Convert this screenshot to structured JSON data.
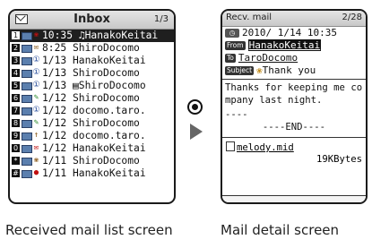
{
  "list_screen": {
    "title": "Inbox",
    "page": "1/3",
    "rows": [
      {
        "num": "1",
        "status": "❀",
        "status_color": "red",
        "text": "10:35 ♫HanakoKeitai",
        "selected": true
      },
      {
        "num": "2",
        "status": "✉",
        "status_color": "brown",
        "text": " 8:25 ShiroDocomo",
        "selected": false
      },
      {
        "num": "3",
        "status": "①",
        "status_color": "blue",
        "text": " 1/13 HanakoKeitai",
        "selected": false
      },
      {
        "num": "4",
        "status": "①",
        "status_color": "blue",
        "text": " 1/13 ShiroDocomo",
        "selected": false
      },
      {
        "num": "5",
        "status": "①",
        "status_color": "blue",
        "text": " 1/13 ▤ShiroDocomo",
        "selected": false
      },
      {
        "num": "6",
        "status": "✎",
        "status_color": "green",
        "text": " 1/12 ShiroDocomo",
        "selected": false
      },
      {
        "num": "7",
        "status": "①",
        "status_color": "blue",
        "text": " 1/12 docomo.taro.",
        "selected": false
      },
      {
        "num": "8",
        "status": "✎",
        "status_color": "green",
        "text": " 1/12 ShiroDocomo",
        "selected": false
      },
      {
        "num": "9",
        "status": "↑",
        "status_color": "brown",
        "text": " 1/12 docomo.taro.",
        "selected": false
      },
      {
        "num": "0",
        "status": "✉",
        "status_color": "red",
        "text": " 1/12 HanakoKeitai",
        "selected": false
      },
      {
        "num": "*",
        "status": "❀",
        "status_color": "brown",
        "text": " 1/11 ShiroDocomo",
        "selected": false
      },
      {
        "num": "#",
        "status": "●",
        "status_color": "red",
        "text": " 1/11 HanakoKeitai",
        "selected": false
      }
    ]
  },
  "detail_screen": {
    "title": "Recv. mail",
    "page": "2/28",
    "date": "2010/ 1/14 10:35",
    "from_label": "From",
    "from": "HanakoKeitai",
    "to_label": "To",
    "to": "TaroDocomo",
    "subject_label": "Subject",
    "subject": "Thank you",
    "body": "Thanks for keeping me company last night.",
    "separator": "----",
    "end": "----END----",
    "attachment_name": "melody.mid",
    "attachment_size": "19KBytes"
  },
  "captions": {
    "list": "Received mail list screen",
    "detail": "Mail detail screen"
  },
  "colors": {
    "selected_row_bg": "#1f1f1f",
    "header_bg": "#c8c8c8",
    "arrow": "#666666"
  },
  "icons": [
    "envelope-icon",
    "select-key-icon",
    "right-arrow-icon",
    "clock-icon",
    "file-icon"
  ]
}
